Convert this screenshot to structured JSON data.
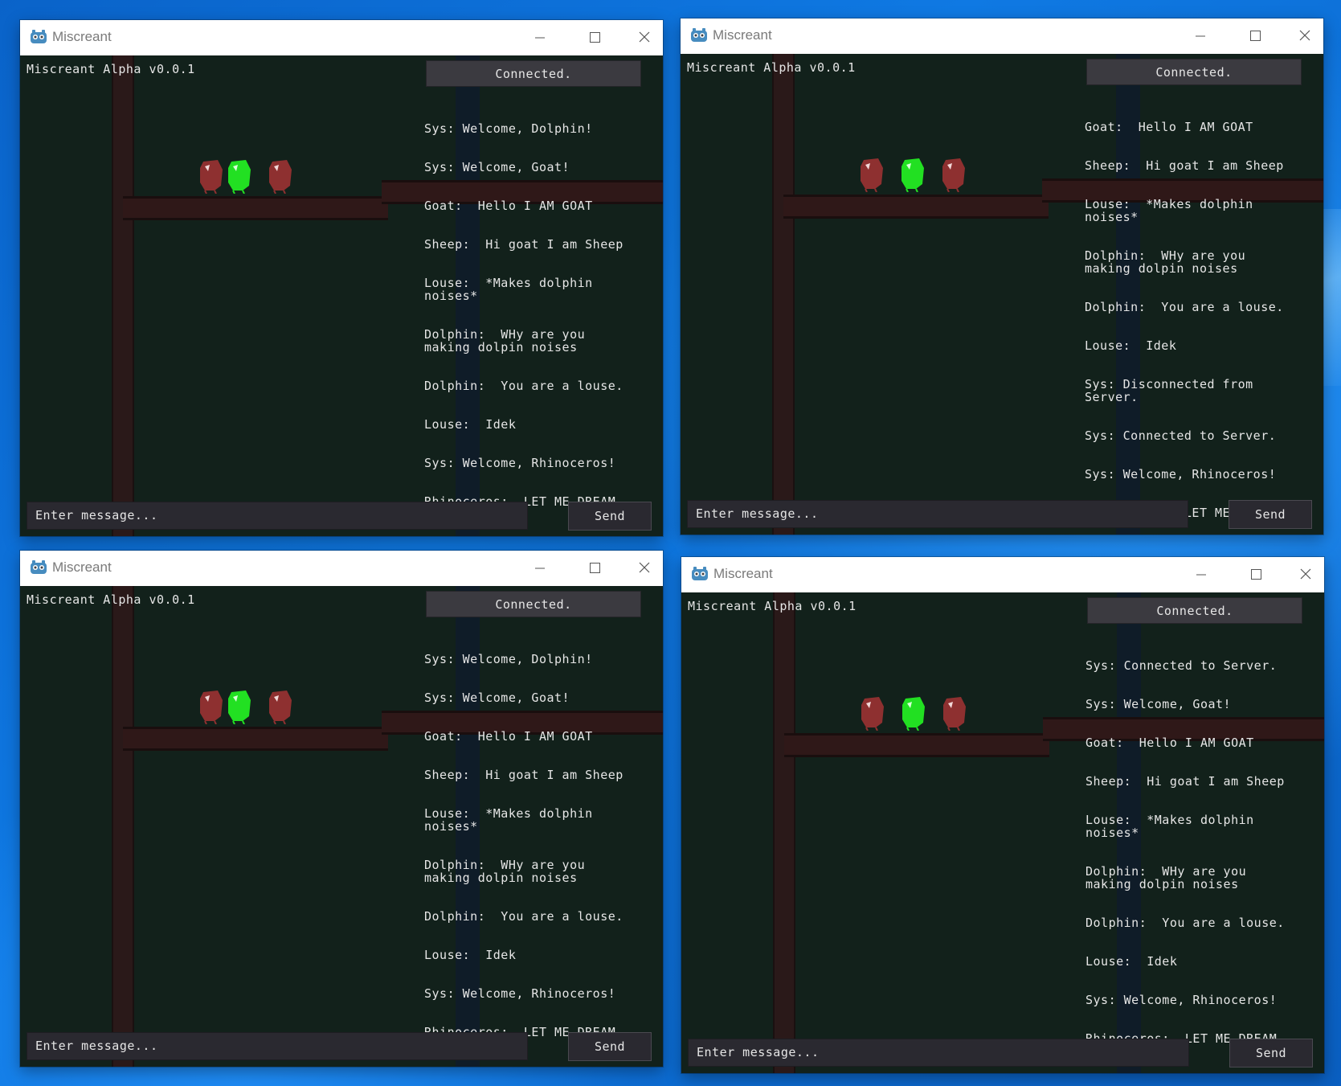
{
  "desktop": {
    "accent": "#0a64c8"
  },
  "windows": [
    {
      "title": "Miscreant",
      "version": "Miscreant Alpha v0.0.1",
      "status": "Connected.",
      "input_placeholder": "Enter message...",
      "send_label": "Send",
      "chat": [
        "Sys: Welcome, Dolphin!",
        "Sys: Welcome, Goat!",
        "Goat:  Hello I AM GOAT",
        "Sheep:  Hi goat I am Sheep",
        "Louse:  *Makes dolphin noises*",
        "Dolphin:  WHy are you making dolpin noises",
        "Dolphin:  You are a louse.",
        "Louse:  Idek",
        "Sys: Welcome, Rhinoceros!",
        "Rhinoceros:  LET ME DREAM"
      ]
    },
    {
      "title": "Miscreant",
      "version": "Miscreant Alpha v0.0.1",
      "status": "Connected.",
      "input_placeholder": "Enter message...",
      "send_label": "Send",
      "chat": [
        "Goat:  Hello I AM GOAT",
        "Sheep:  Hi goat I am Sheep",
        "Louse:  *Makes dolphin noises*",
        "Dolphin:  WHy are you making dolpin noises",
        "Dolphin:  You are a louse.",
        "Louse:  Idek",
        "Sys: Disconnected from Server.",
        "Sys: Connected to Server.",
        "Sys: Welcome, Rhinoceros!",
        "Rhinoceros:  LET ME DREAM"
      ]
    },
    {
      "title": "Miscreant",
      "version": "Miscreant Alpha v0.0.1",
      "status": "Connected.",
      "input_placeholder": "Enter message...",
      "send_label": "Send",
      "chat": [
        "Sys: Welcome, Dolphin!",
        "Sys: Welcome, Goat!",
        "Goat:  Hello I AM GOAT",
        "Sheep:  Hi goat I am Sheep",
        "Louse:  *Makes dolphin noises*",
        "Dolphin:  WHy are you making dolpin noises",
        "Dolphin:  You are a louse.",
        "Louse:  Idek",
        "Sys: Welcome, Rhinoceros!",
        "Rhinoceros:  LET ME DREAM"
      ]
    },
    {
      "title": "Miscreant",
      "version": "Miscreant Alpha v0.0.1",
      "status": "Connected.",
      "input_placeholder": "Enter message...",
      "send_label": "Send",
      "chat": [
        "Sys: Connected to Server.",
        "Sys: Welcome, Goat!",
        "Goat:  Hello I AM GOAT",
        "Sheep:  Hi goat I am Sheep",
        "Louse:  *Makes dolphin noises*",
        "Dolphin:  WHy are you making dolpin noises",
        "Dolphin:  You are a louse.",
        "Louse:  Idek",
        "Sys: Welcome, Rhinoceros!",
        "Rhinoceros:  LET ME DREAM"
      ]
    }
  ],
  "colors": {
    "game_bg": "#12211b",
    "player_local": "#22e022",
    "player_other": "#8e3030",
    "ui_button": "#3b3a40"
  },
  "icons": {
    "app": "godot-icon",
    "minimize": "minimize-icon",
    "maximize": "maximize-icon",
    "close": "close-icon"
  }
}
